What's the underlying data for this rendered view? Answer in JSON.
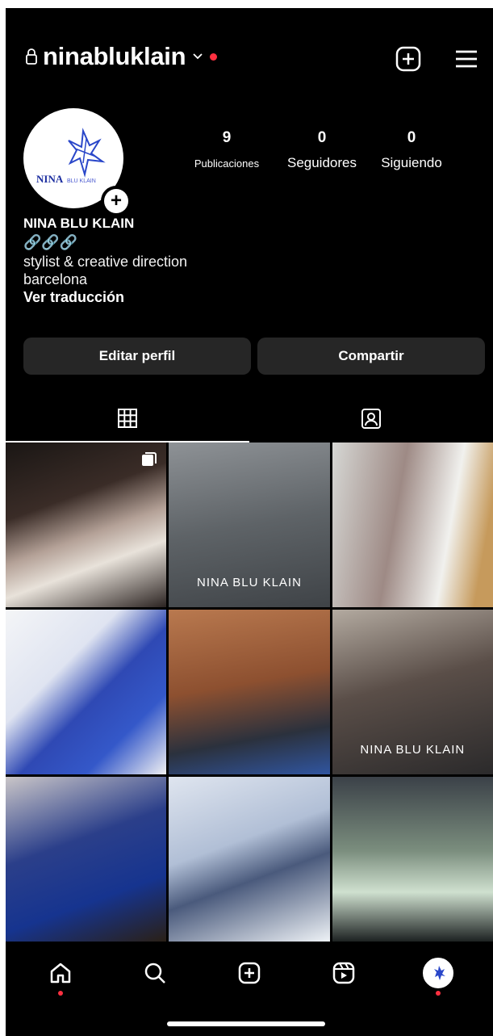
{
  "header": {
    "username": "ninabluklain",
    "lock_icon": "lock-icon",
    "add_icon": "plus-square-icon",
    "menu_icon": "hamburger-menu-icon"
  },
  "profile": {
    "avatar_logo_text": "NINA BLU KLAIN",
    "stats": [
      {
        "value": "9",
        "label": "Publicaciones"
      },
      {
        "value": "0",
        "label": "Seguidores"
      },
      {
        "value": "0",
        "label": "Siguiendo"
      }
    ],
    "display_name": "NINA BLU KLAIN",
    "emoji_line": "🔗🔗🔗",
    "bio_lines": [
      "stylist & creative direction",
      "barcelona"
    ],
    "translate_link": "Ver traducción"
  },
  "actions": {
    "edit_label": "Editar perfil",
    "share_label": "Compartir"
  },
  "tabs": [
    {
      "icon": "grid-icon",
      "active": true
    },
    {
      "icon": "tagged-person-icon",
      "active": false
    }
  ],
  "grid": {
    "posts": [
      {
        "overlay": "",
        "multi": true
      },
      {
        "overlay": "NINA BLU KLAIN",
        "multi": false
      },
      {
        "overlay": "",
        "multi": false
      },
      {
        "overlay": "",
        "multi": false
      },
      {
        "overlay": "",
        "multi": false
      },
      {
        "overlay": "NINA BLU KLAIN",
        "multi": false
      },
      {
        "overlay": "",
        "multi": false
      },
      {
        "overlay": "",
        "multi": false
      },
      {
        "overlay": "",
        "multi": false
      }
    ]
  },
  "bottom_nav": [
    {
      "icon": "home-icon",
      "notification": true
    },
    {
      "icon": "search-icon",
      "notification": false
    },
    {
      "icon": "create-icon",
      "notification": false
    },
    {
      "icon": "reels-icon",
      "notification": false
    },
    {
      "icon": "profile-avatar-icon",
      "notification": true
    }
  ],
  "colors": {
    "background": "#000000",
    "button_bg": "#262626",
    "notification_red": "#ff3040"
  }
}
